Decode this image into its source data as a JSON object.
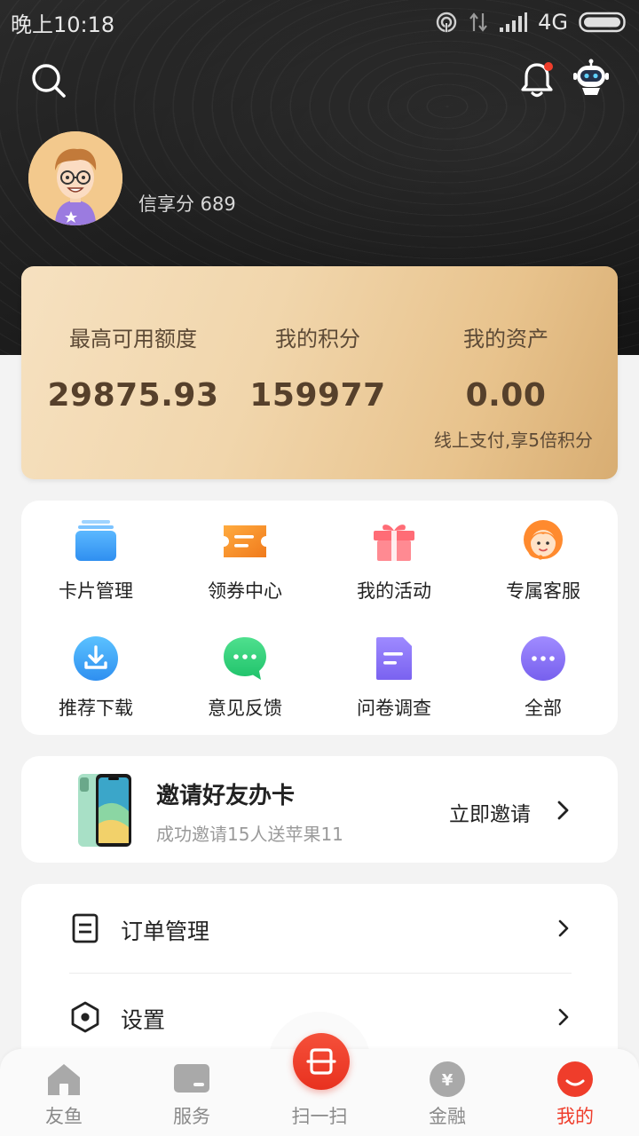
{
  "status_bar": {
    "time": "晚上10:18",
    "network": "4G"
  },
  "header": {
    "search_icon": "search-icon",
    "bell_icon": "bell-icon",
    "robot_icon": "robot-assistant-icon",
    "score_text": "信享分 689"
  },
  "assets": {
    "columns": [
      {
        "label": "最高可用额度",
        "value": "29875.93"
      },
      {
        "label": "我的积分",
        "value": "159977"
      },
      {
        "label": "我的资产",
        "value": "0.00"
      }
    ],
    "note": "线上支付,享5倍积分"
  },
  "grid": {
    "items": [
      {
        "label": "卡片管理",
        "icon": "card-icon"
      },
      {
        "label": "领券中心",
        "icon": "coupon-icon"
      },
      {
        "label": "我的活动",
        "icon": "gift-icon"
      },
      {
        "label": "专属客服",
        "icon": "customer-service-icon"
      },
      {
        "label": "推荐下载",
        "icon": "download-icon"
      },
      {
        "label": "意见反馈",
        "icon": "feedback-icon"
      },
      {
        "label": "问卷调查",
        "icon": "survey-icon"
      },
      {
        "label": "全部",
        "icon": "more-icon"
      }
    ]
  },
  "invite": {
    "title": "邀请好友办卡",
    "subtitle": "成功邀请15人送苹果11",
    "cta": "立即邀请"
  },
  "menu": {
    "items": [
      {
        "label": "订单管理",
        "icon": "order-icon"
      },
      {
        "label": "设置",
        "icon": "settings-icon"
      }
    ]
  },
  "bottom_nav": {
    "items": [
      {
        "label": "友鱼",
        "icon": "home-icon"
      },
      {
        "label": "服务",
        "icon": "service-icon"
      },
      {
        "label": "扫一扫",
        "icon": "scan-icon"
      },
      {
        "label": "金融",
        "icon": "finance-icon"
      },
      {
        "label": "我的",
        "icon": "profile-icon"
      }
    ],
    "active": "我的",
    "accent_color": "#ef3d2b"
  }
}
